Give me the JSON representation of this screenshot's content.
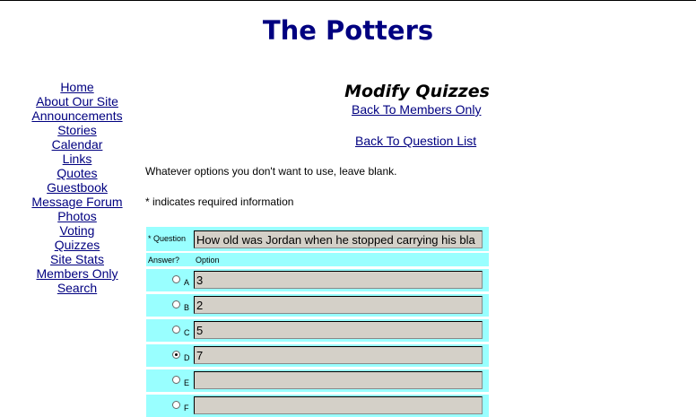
{
  "site_title": "The Potters",
  "nav": [
    "Home",
    "About Our Site",
    "Announcements",
    "Stories",
    "Calendar",
    "Links",
    "Quotes",
    "Guestbook",
    "Message Forum",
    "Photos",
    "Voting",
    "Quizzes",
    "Site Stats",
    "Members Only",
    "Search"
  ],
  "page": {
    "title": "Modify Quizzes",
    "back_members": "Back To Members Only",
    "back_questions": "Back To Question List",
    "note_blank": "Whatever options you don't want to use, leave blank.",
    "note_required": "* indicates required information"
  },
  "form": {
    "question_label": "* Question",
    "question_value": "How old was Jordan when he stopped carrying his bla",
    "answer_header": "Answer?",
    "option_header": "Option",
    "options": [
      {
        "letter": "A",
        "value": "3",
        "selected": false
      },
      {
        "letter": "B",
        "value": "2",
        "selected": false
      },
      {
        "letter": "C",
        "value": "5",
        "selected": false
      },
      {
        "letter": "D",
        "value": "7",
        "selected": true
      },
      {
        "letter": "E",
        "value": "",
        "selected": false
      },
      {
        "letter": "F",
        "value": "",
        "selected": false
      }
    ]
  }
}
